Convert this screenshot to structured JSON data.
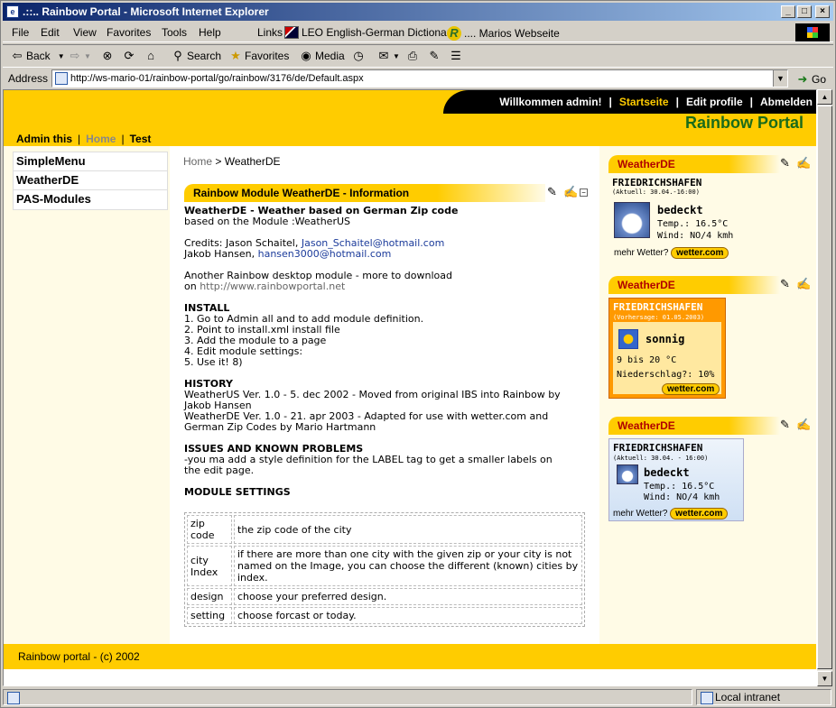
{
  "window": {
    "title": ".::.. Rainbow Portal - Microsoft Internet Explorer",
    "buttons": [
      "_",
      "□",
      "×"
    ]
  },
  "menu": {
    "items": [
      "File",
      "Edit",
      "View",
      "Favorites",
      "Tools",
      "Help"
    ],
    "links_label": "Links",
    "link1": "LEO English-German Dictionary",
    "link2": ".... Marios Webseite"
  },
  "toolbar": {
    "back": "Back",
    "search": "Search",
    "favorites": "Favorites",
    "media": "Media"
  },
  "address": {
    "label": "Address",
    "url": "http://ws-mario-01/rainbow-portal/go/rainbow/3176/de/Default.aspx",
    "go": "Go"
  },
  "status": {
    "zone": "Local intranet"
  },
  "portal": {
    "toplinks": [
      "Willkommen admin!",
      "Startseite",
      "Edit profile",
      "Abmelden"
    ],
    "title": "Rainbow Portal",
    "adminbar": [
      "Admin this",
      "Home",
      "Test"
    ],
    "leftmenu": [
      "SimpleMenu",
      "WeatherDE",
      "PAS-Modules"
    ],
    "breadcrumb": {
      "home": "Home",
      "sep": ">",
      "current": "WeatherDE"
    },
    "module_title": "Rainbow Module WeatherDE - Information",
    "content": {
      "h1": "WeatherDE - Weather based on German Zip code",
      "based": "based on the Module :WeatherUS",
      "credits1": "Credits: Jason Schaitel, ",
      "credits1_link": "Jason_Schaitel@hotmail.com",
      "credits2": "Jakob Hansen, ",
      "credits2_link": "hansen3000@hotmail.com",
      "another": "Another Rainbow desktop module - more to download",
      "on": "on ",
      "on_link": "http://www.rainbowportal.net",
      "install_h": "INSTALL",
      "install": [
        "1. Go to Admin all and to add module definition.",
        "2. Point to install.xml install file",
        "3. Add the module to a page",
        "4. Edit module settings:",
        "5. Use it! 8)"
      ],
      "history_h": "HISTORY",
      "history1": "WeatherUS Ver. 1.0 - 5. dec 2002 - Moved from original IBS into Rainbow by",
      "history1b": "Jakob Hansen",
      "history2": "WeatherDE Ver. 1.0 - 21. apr 2003 - Adapted for use with wetter.com and",
      "history2b": "German Zip Codes by Mario Hartmann",
      "issues_h": "ISSUES AND KNOWN PROBLEMS",
      "issues1": "-you ma add a style definition for the LABEL tag to get a smaller labels on",
      "issues2": "the edit page.",
      "settings_h": "MODULE SETTINGS"
    },
    "settings_rows": [
      {
        "k1": "zip",
        "k2": "code",
        "v": "the zip code of the city"
      },
      {
        "k1": "city",
        "k2": "Index",
        "v": "if there are more than one city with the given zip or your city is not named on the Image, you can choose the different (known) cities by index."
      },
      {
        "k1": "design",
        "k2": "",
        "v": " choose your preferred design."
      },
      {
        "k1": "setting",
        "k2": "",
        "v": "choose forcast or today."
      }
    ],
    "footer": "Rainbow portal - (c) 2002",
    "weather_title": "WeatherDE",
    "wx1": {
      "city": "FRIEDRICHSHAFEN",
      "stamp": "(Aktuell: 30.04.-16:00)",
      "cond": "bedeckt",
      "temp": "Temp.: 16.5°C",
      "wind": "Wind: NO/4 kmh",
      "more": "mehr Wetter?",
      "btn": "wetter.com"
    },
    "wx2": {
      "city": "FRIEDRICHSHAFEN",
      "stamp": "(Vorhersage: 01.05.2003)",
      "cond": "sonnig",
      "temp": "9 bis 20 °C",
      "rain": "Niederschlag?: 10%",
      "btn": "wetter.com"
    },
    "wx3": {
      "city": "FRIEDRICHSHAFEN",
      "stamp": "(Aktuell:  30.04. - 16:00)",
      "cond": "bedeckt",
      "temp": "Temp.: 16.5°C",
      "wind": "Wind: NO/4 kmh",
      "more": "mehr Wetter?",
      "btn": "wetter.com"
    }
  }
}
